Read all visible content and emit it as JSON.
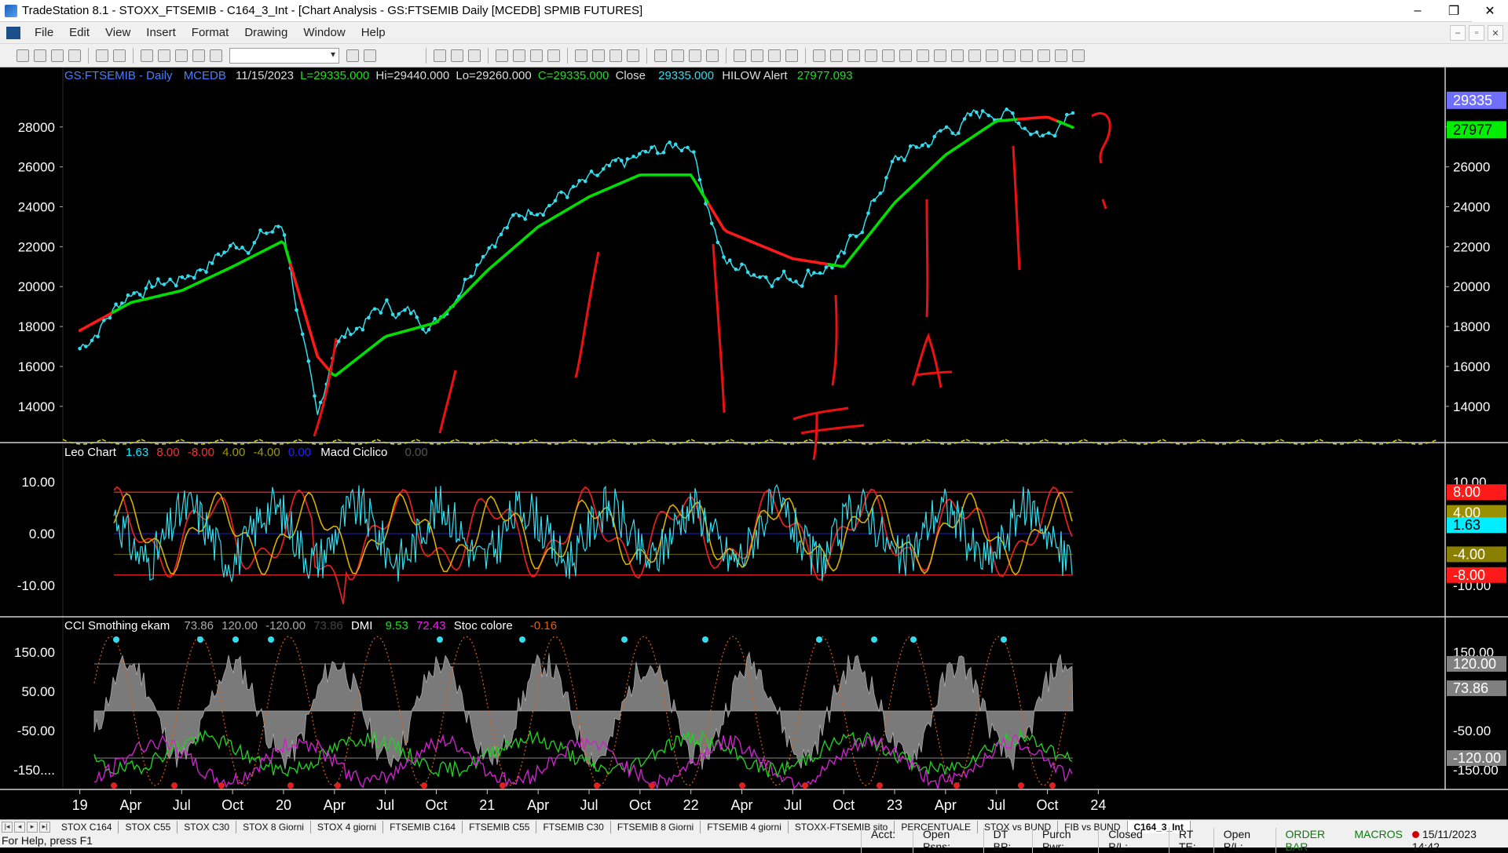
{
  "window": {
    "title": "TradeStation 8.1 - STOXX_FTSEMIB - C164_3_Int - [Chart Analysis - GS:FTSEMIB  Daily  [MCEDB] SPMIB FUTURES]",
    "controls": [
      "–",
      "❐",
      "✕"
    ]
  },
  "menu": {
    "items": [
      "File",
      "Edit",
      "View",
      "Insert",
      "Format",
      "Drawing",
      "Window",
      "Help"
    ],
    "mdi_controls": [
      "–",
      "▫",
      "✕"
    ]
  },
  "price_panel": {
    "symbol": "GS:FTSEMIB - Daily",
    "source": "MCEDB",
    "date": "11/15/2023",
    "last": "L=29335.000",
    "high": "Hi=29440.000",
    "low": "Lo=29260.000",
    "close_eq": "C=29335.000",
    "close_label": "Close",
    "close_value": "29335.000",
    "alert_label": "HILOW Alert",
    "alert_value": "27977.093",
    "y_ticks": [
      "28000",
      "26000",
      "24000",
      "22000",
      "20000",
      "18000",
      "16000",
      "14000"
    ],
    "right_ticks": [
      "28000",
      "26000",
      "24000",
      "22000",
      "20000",
      "18000",
      "16000",
      "14000"
    ],
    "last_badge": "29335",
    "alert_badge": "27977",
    "price_color": "#33ddee",
    "up_color": "#00e000",
    "down_color": "#ff1a1a",
    "badge_last_color": "#6f6fff",
    "badge_alert_color": "#00ee00"
  },
  "macd_panel": {
    "name": "Leo Chart",
    "v1": "1.63",
    "v2": "8.00",
    "v3": "-8.00",
    "v4": "4.00",
    "v5": "-4.00",
    "v6": "0.00",
    "name2": "Macd Ciclico",
    "v7": "0.00",
    "y_ticks": [
      "10.00",
      "0.00",
      "-10.00"
    ],
    "right_ticks": [
      "10.00",
      "-10.00"
    ],
    "badges": [
      "8.00",
      "4.00",
      "1.63",
      "-4.00",
      "-8.00"
    ],
    "badge_colors": [
      "#ff1a1a",
      "#9a9000",
      "#00eeff",
      "#8a8000",
      "#ff1a1a"
    ]
  },
  "cci_panel": {
    "name": "CCI Smothing ekam",
    "v1": "73.86",
    "v2": "120.00",
    "v3": "-120.00",
    "v4": "73.86",
    "dmi_label": "DMI",
    "dmi1": "9.53",
    "dmi2": "72.43",
    "stoc_label": "Stoc colore",
    "stoc_value": "-0.16",
    "y_ticks": [
      "150.00",
      "50.00",
      "-50.00",
      "-150...."
    ],
    "right_ticks": [
      "150.00",
      "-50.00",
      "-150.00"
    ],
    "badges": [
      "120.00",
      "73.86",
      "-120.00"
    ]
  },
  "time_axis": {
    "labels": [
      "19",
      "Apr",
      "Jul",
      "Oct",
      "20",
      "Apr",
      "Jul",
      "Oct",
      "21",
      "Apr",
      "Jul",
      "Oct",
      "22",
      "Apr",
      "Jul",
      "Oct",
      "23",
      "Apr",
      "Jul",
      "Oct",
      "24"
    ]
  },
  "annotations": {
    "letters": [
      "?",
      "F",
      "A"
    ]
  },
  "tabs": [
    "STOX C164",
    "STOX C55",
    "STOX  C30",
    "STOX  8 Giorni",
    "STOX 4 giorni",
    "FTSEMIB C164",
    "FTSEMIB C55",
    "FTSEMIB C30",
    "FTSEMIB  8 Giorni",
    "FTSEMIB  4 giorni",
    "STOXX-FTSEMIB sito",
    "PERCENTUALE",
    "STOX vs BUND",
    "FIB vs BUND",
    "C164_3_Int"
  ],
  "status": {
    "help": "For Help, press F1",
    "fields": [
      "Acct:",
      "Open Psns:",
      "DT BP:",
      "Purch Pwr:",
      "Closed P/L:",
      "RT TE:",
      "Open P/L:"
    ],
    "order_bar": "ORDER BAR",
    "macros": "MACROS",
    "datetime": "15/11/2023 14:42"
  },
  "chart_data": {
    "type": "line",
    "title": "GS:FTSEMIB - Daily",
    "ylim": [
      12500,
      29800
    ],
    "x": [
      "2019-01",
      "2019-04",
      "2019-07",
      "2019-10",
      "2020-01",
      "2020-03",
      "2020-04",
      "2020-07",
      "2020-10",
      "2021-01",
      "2021-04",
      "2021-07",
      "2021-10",
      "2022-01",
      "2022-03",
      "2022-07",
      "2022-10",
      "2023-01",
      "2023-04",
      "2023-07",
      "2023-10",
      "2023-11"
    ],
    "series": [
      {
        "name": "Close",
        "values": [
          16900,
          19800,
          20400,
          22000,
          23000,
          13000,
          17200,
          19000,
          18200,
          22300,
          24200,
          25100,
          26400,
          27300,
          21100,
          20500,
          21400,
          26200,
          27800,
          28900,
          27600,
          29335
        ]
      },
      {
        "name": "HILOW Alert",
        "values": [
          17800,
          19200,
          19800,
          21000,
          22300,
          16500,
          15500,
          17500,
          18200,
          20800,
          23000,
          24500,
          25600,
          25600,
          22800,
          21400,
          21000,
          24200,
          26600,
          28300,
          28500,
          27977
        ]
      }
    ]
  }
}
